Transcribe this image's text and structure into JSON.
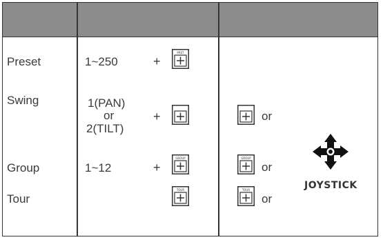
{
  "rows": [
    {
      "label": "Preset",
      "range": "1~250",
      "key_text": "PRST"
    },
    {
      "label": "Swing",
      "range_lines": [
        "1(PAN)",
        "or",
        "2(TILT)"
      ]
    },
    {
      "label": "Group",
      "range": "1~12",
      "key_text": "GROUP"
    },
    {
      "label": "Tour",
      "key_text": "TOUR"
    }
  ],
  "plus_sign": "+",
  "or_text": "or",
  "joystick_label": "JOYSTICK",
  "colors": {
    "header": "#8c8c8c",
    "border": "#333333",
    "text": "#3a3a3a"
  }
}
